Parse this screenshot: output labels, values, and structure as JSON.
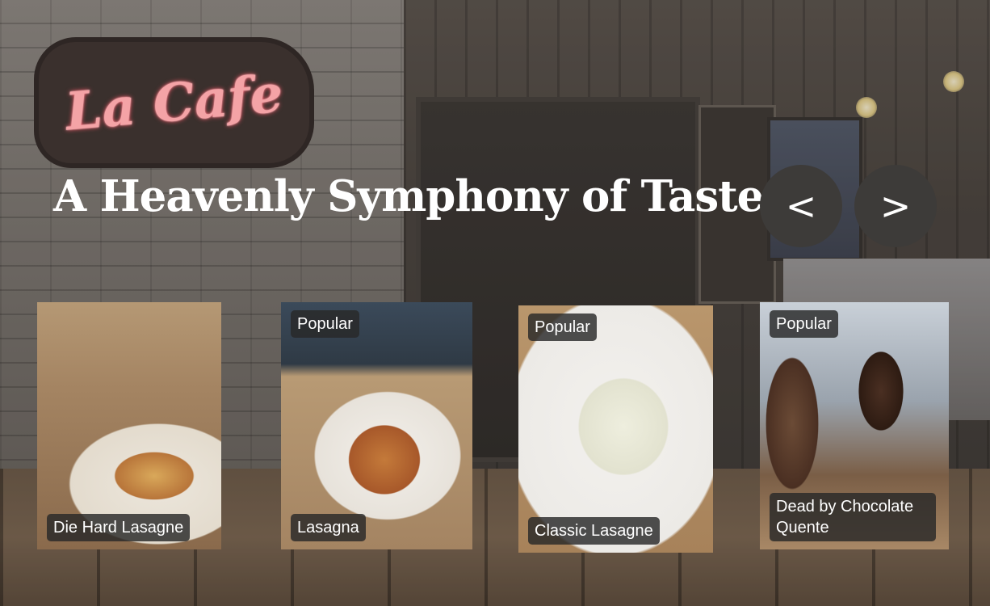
{
  "logo": {
    "text": "La Cafe"
  },
  "headline": "A Heavenly Symphony of Taste",
  "nav": {
    "prev_label": "<",
    "next_label": ">"
  },
  "cards": [
    {
      "badge": "",
      "caption": "Die Hard Lasagne"
    },
    {
      "badge": "Popular",
      "caption": "Lasagna"
    },
    {
      "badge": "Popular",
      "caption": "Classic Lasagne"
    },
    {
      "badge": "Popular",
      "caption": "Dead by Chocolate Quente"
    }
  ]
}
